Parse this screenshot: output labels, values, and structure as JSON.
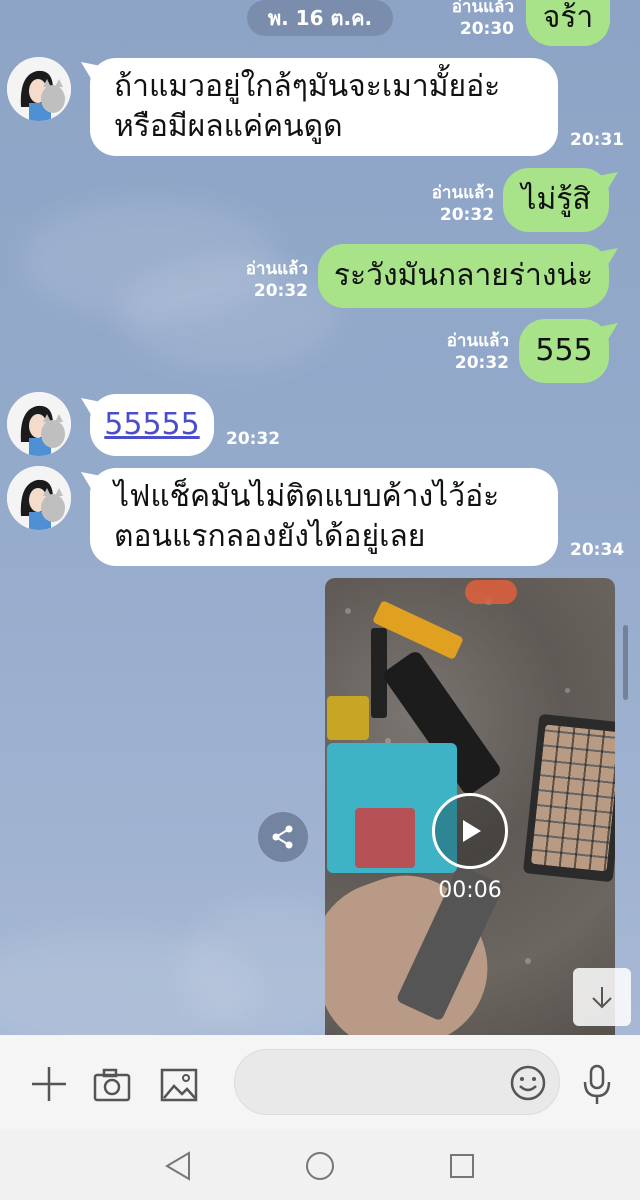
{
  "date_divider": "พ. 16 ต.ค.",
  "messages": [
    {
      "side": "out",
      "read": "อ่านแล้ว",
      "time": "20:30",
      "lines": [
        "จร้า"
      ]
    },
    {
      "side": "in",
      "time": "20:31",
      "lines": [
        "ถ้าแมวอยู่ใกล้ๆมันจะเมามั้ยอ่ะ",
        "หรือมีผลแค่คนดูด"
      ]
    },
    {
      "side": "out",
      "read": "อ่านแล้ว",
      "time": "20:32",
      "lines": [
        "ไม่รู้สิ"
      ]
    },
    {
      "side": "out",
      "read": "อ่านแล้ว",
      "time": "20:32",
      "lines": [
        "ระวังมันกลายร่างน่ะ"
      ]
    },
    {
      "side": "out",
      "read": "อ่านแล้ว",
      "time": "20:32",
      "lines": [
        "555"
      ]
    },
    {
      "side": "in",
      "time": "20:32",
      "lines": [
        "55555"
      ]
    },
    {
      "side": "in",
      "time": "20:34",
      "lines": [
        "ไฟแช็คมันไม่ติดแบบค้างไว้อ่ะ",
        "ตอนแรกลองยังได้อยู่เลย"
      ]
    }
  ],
  "video": {
    "duration": "00:06"
  },
  "icons": {
    "share": "share-icon",
    "scroll_down": "arrow-down-icon",
    "plus": "plus-icon",
    "camera": "camera-icon",
    "gallery": "image-icon",
    "emoji": "emoji-icon",
    "mic": "microphone-icon",
    "back": "nav-back-icon",
    "home": "nav-home-icon",
    "recents": "nav-recents-icon"
  },
  "colors": {
    "outgoing_bubble": "#a8e38a",
    "incoming_bubble": "#ffffff",
    "chat_background": "#93a9ca",
    "link": "#4b4ecb"
  }
}
